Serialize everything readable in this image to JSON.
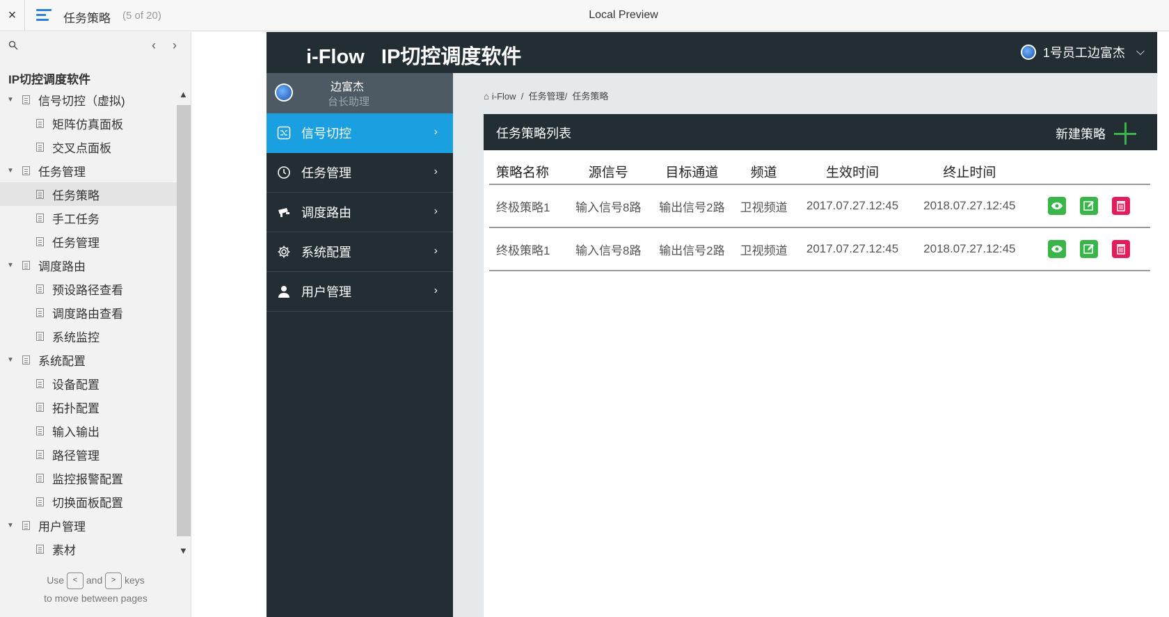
{
  "topbar": {
    "close": "×",
    "title": "任务策略",
    "count": "(5 of 20)",
    "center": "Local Preview"
  },
  "outline": {
    "root": "IP切控调度软件",
    "tree": [
      {
        "label": "信号切控（虚拟)",
        "level": 1
      },
      {
        "label": "矩阵仿真面板",
        "level": 2
      },
      {
        "label": "交叉点面板",
        "level": 2
      },
      {
        "label": "任务管理",
        "level": 1
      },
      {
        "label": "任务策略",
        "level": 2,
        "active": true
      },
      {
        "label": "手工任务",
        "level": 2
      },
      {
        "label": "任务管理",
        "level": 2
      },
      {
        "label": "调度路由",
        "level": 1
      },
      {
        "label": "预设路径查看",
        "level": 2
      },
      {
        "label": "调度路由查看",
        "level": 2
      },
      {
        "label": "系统监控",
        "level": 2
      },
      {
        "label": "系统配置",
        "level": 1
      },
      {
        "label": "设备配置",
        "level": 2
      },
      {
        "label": "拓扑配置",
        "level": 2
      },
      {
        "label": "输入输出",
        "level": 2
      },
      {
        "label": "路径管理",
        "level": 2
      },
      {
        "label": "监控报警配置",
        "level": 2
      },
      {
        "label": "切换面板配置",
        "level": 2
      },
      {
        "label": "用户管理",
        "level": 1
      },
      {
        "label": "素材",
        "level": 2
      }
    ],
    "hint_use": "Use",
    "hint_and": "and",
    "hint_keys": "keys",
    "hint_line2": "to move between pages"
  },
  "app": {
    "title": "i-Flow   IP切控调度软件",
    "user": "1号员工边富杰",
    "profile_name": "边富杰",
    "profile_role": "台长助理",
    "menu": [
      {
        "label": "信号切控",
        "icon": "shuffle-icon",
        "active": true
      },
      {
        "label": "任务管理",
        "icon": "clock-icon"
      },
      {
        "label": "调度路由",
        "icon": "camera-icon"
      },
      {
        "label": "系统配置",
        "icon": "gear-icon"
      },
      {
        "label": "用户管理",
        "icon": "user-icon"
      }
    ],
    "breadcrumb": "i-Flow  /  任务管理/  任务策略",
    "panel_title": "任务策略列表",
    "new_button": "新建策略",
    "columns": [
      "策略名称",
      "源信号",
      "目标通道",
      "频道",
      "生效时间",
      "终止时间",
      ""
    ],
    "rows": [
      [
        "终极策略1",
        "输入信号8路",
        "输出信号2路",
        "卫视频道",
        "2017.07.27.12:45",
        "2018.07.27.12:45"
      ],
      [
        "终极策略1",
        "输入信号8路",
        "输出信号2路",
        "卫视频道",
        "2017.07.27.12:45",
        "2018.07.27.12:45"
      ]
    ]
  },
  "colors": {
    "dark": "#232d34",
    "accent": "#1aa0e0",
    "green": "#3ab54a",
    "red": "#e21d5c"
  }
}
